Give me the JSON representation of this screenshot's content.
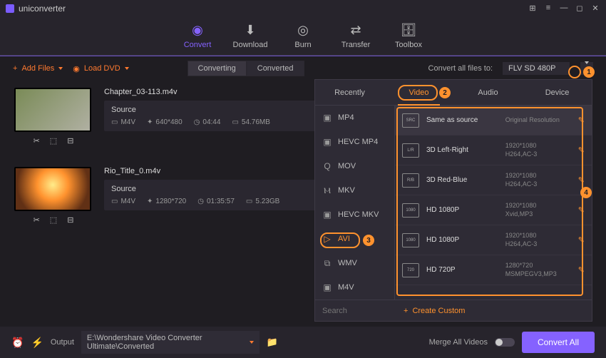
{
  "app": {
    "name": "uniconverter"
  },
  "nav": {
    "convert": "Convert",
    "download": "Download",
    "burn": "Burn",
    "transfer": "Transfer",
    "toolbox": "Toolbox"
  },
  "toolbar": {
    "add": "Add Files",
    "dvd": "Load DVD",
    "converting": "Converting",
    "converted": "Converted",
    "convert_lab": "Convert all files to:",
    "output_sel": "FLV SD 480P"
  },
  "files": [
    {
      "name": "Chapter_03-113.m4v",
      "source": "Source",
      "fmt": "M4V",
      "res": "640*480",
      "dur": "04:44",
      "size": "54.76MB"
    },
    {
      "name": "Rio_Title_0.m4v",
      "source": "Source",
      "fmt": "M4V",
      "res": "1280*720",
      "dur": "01:35:57",
      "size": "5.23GB"
    }
  ],
  "footer": {
    "output": "Output",
    "path": "E:\\Wondershare Video Converter Ultimate\\Converted",
    "merge": "Merge All Videos",
    "convert": "Convert All"
  },
  "panel": {
    "tabs": {
      "recently": "Recently",
      "video": "Video",
      "audio": "Audio",
      "device": "Device"
    },
    "formats": [
      "MP4",
      "HEVC MP4",
      "MOV",
      "MKV",
      "HEVC MKV",
      "AVI",
      "WMV",
      "M4V"
    ],
    "presets": [
      {
        "name": "Same as source",
        "res": "Original Resolution",
        "codec": ""
      },
      {
        "name": "3D Left-Right",
        "res": "1920*1080",
        "codec": "H264,AC-3"
      },
      {
        "name": "3D Red-Blue",
        "res": "1920*1080",
        "codec": "H264,AC-3"
      },
      {
        "name": "HD 1080P",
        "res": "1920*1080",
        "codec": "Xvid,MP3"
      },
      {
        "name": "HD 1080P",
        "res": "1920*1080",
        "codec": "H264,AC-3"
      },
      {
        "name": "HD 720P",
        "res": "1280*720",
        "codec": "MSMPEGV3,MP3"
      }
    ],
    "search": "Search",
    "create": "Create Custom"
  },
  "callouts": [
    "1",
    "2",
    "3",
    "4"
  ]
}
